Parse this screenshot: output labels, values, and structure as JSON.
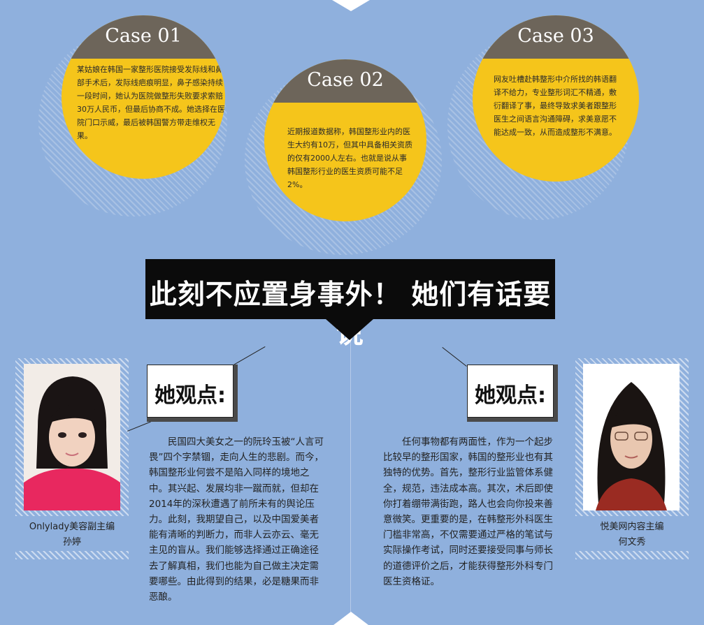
{
  "colors": {
    "background": "#8fb0dd",
    "circle": "#f5c51b",
    "cap": "#6d655a",
    "banner": "#0b0b0b"
  },
  "cases": [
    {
      "label": "Case 01",
      "text": "某姑娘在韩国一家整形医院接受发际线和鼻部手术后，发际线疤痕明显，鼻子感染持续一段时间，她认为医院做整形失败要求索赔30万人民币，但最后协商不成。她选择在医院门口示威，最后被韩国警方带走维权无果。"
    },
    {
      "label": "Case 02",
      "text": "近期报道数据称，韩国整形业内的医生大约有10万，但其中具备相关资质的仅有2000人左右。也就是说从事韩国整形行业的医生资质可能不足2%。"
    },
    {
      "label": "Case 03",
      "text": "网友吐槽赴韩整形中介所找的韩语翻译不给力，专业整形词汇不精通，敷衍翻译了事，最终导致求美者跟整形医生之间语言沟通障碍，求美意愿不能达成一致，从而造成整形不满意。"
    }
  ],
  "banner": {
    "title": "此刻不应置身事外！ 她们有话要说"
  },
  "left": {
    "view_title": "她观点:",
    "caption_role": "Onlylady美容副主编",
    "caption_name": "孙婷",
    "speech": "民国四大美女之一的阮玲玉被“人言可畏”四个字禁锢，走向人生的悲剧。而今，韩国整形业何尝不是陷入同样的境地之中。其兴起、发展均非一蹴而就，但却在2014年的深秋遭遇了前所未有的舆论压力。此刻，我期望自己，以及中国爱美者能有清晰的判断力，而非人云亦云、毫无主见的盲从。我们能够选择通过正确途径去了解真相，我们也能为自己做主决定需要哪些。由此得到的结果，必是糖果而非恶酿。"
  },
  "right": {
    "view_title": "她观点:",
    "caption_role": "悦美网内容主编",
    "caption_name": "何文秀",
    "speech": "任何事物都有两面性，作为一个起步比较早的整形国家，韩国的整形业也有其独特的优势。首先，整形行业监管体系健全，规范，违法成本高。其次，术后即使你打着绷带满街跑，路人也会向你投来善意微笑。更重要的是，在韩整形外科医生门槛非常高，不仅需要通过严格的笔试与实际操作考试，同时还要接受同事与师长的道德评价之后，才能获得整形外科专门医生资格证。"
  }
}
